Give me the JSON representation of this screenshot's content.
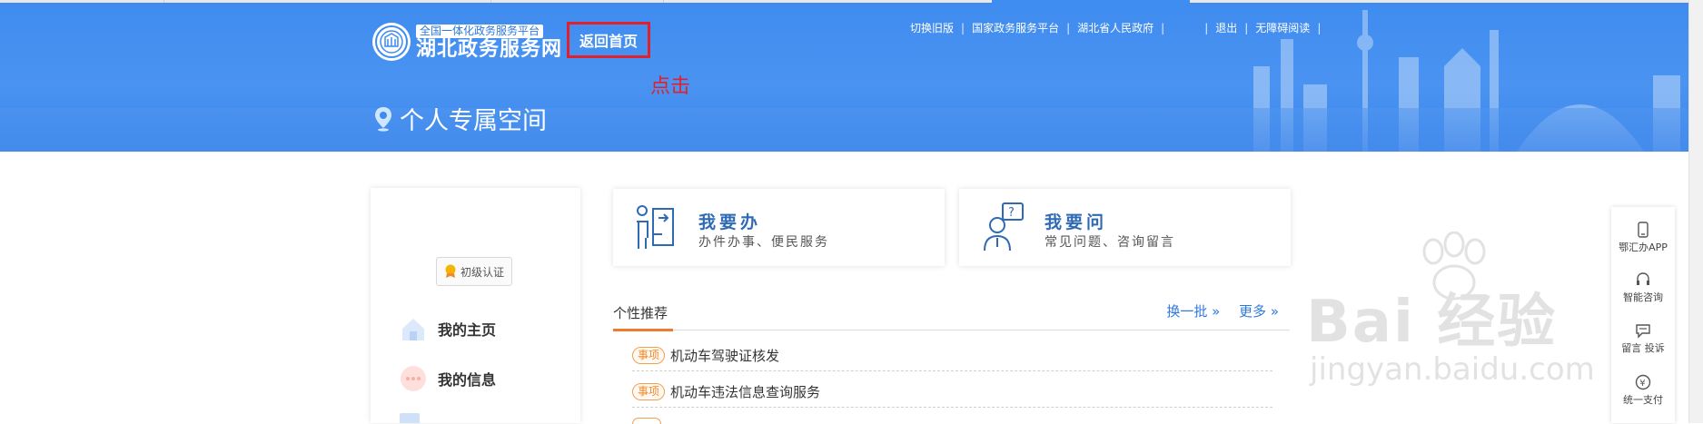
{
  "header": {
    "logo_top": "全国一体化政务服务平台",
    "logo_main": "湖北政务服务网",
    "home_button": "返回首页",
    "click_note": "点击",
    "links": [
      "切换旧版",
      "国家政务服务平台",
      "湖北省人民政府",
      "退出",
      "无障碍阅读"
    ],
    "space_title": "个人专属空间"
  },
  "sidebar": {
    "auth_label": "初级认证",
    "items": [
      {
        "label": "我的主页",
        "icon": "home-icon"
      },
      {
        "label": "我的信息",
        "icon": "message-icon"
      }
    ]
  },
  "actions": [
    {
      "title": "我要办",
      "subtitle": "办件办事、便民服务",
      "icon": "handle-affairs-icon"
    },
    {
      "title": "我要问",
      "subtitle": "常见问题、咨询留言",
      "icon": "consult-icon"
    }
  ],
  "recommend": {
    "title": "个性推荐",
    "refresh": "换一批 »",
    "more": "更多 »",
    "items": [
      {
        "tag": "事项",
        "text": "机动车驾驶证核发"
      },
      {
        "tag": "事项",
        "text": "机动车违法信息查询服务"
      }
    ]
  },
  "floatbar": [
    {
      "label": "鄂汇办APP",
      "icon": "phone-icon"
    },
    {
      "label": "智能咨询",
      "icon": "headset-icon"
    },
    {
      "label": "留言 投诉",
      "icon": "chat-icon"
    },
    {
      "label": "统一支付",
      "icon": "yuan-icon"
    }
  ],
  "watermark": {
    "text": "Bai 经验",
    "sub": "jingyan.baidu.com"
  },
  "colors": {
    "banner": "#3f8cf0",
    "accent_red": "#e0212d",
    "link_blue": "#2f78dd",
    "tag_orange": "#f08a2c",
    "underline_orange": "#f07a2e"
  }
}
